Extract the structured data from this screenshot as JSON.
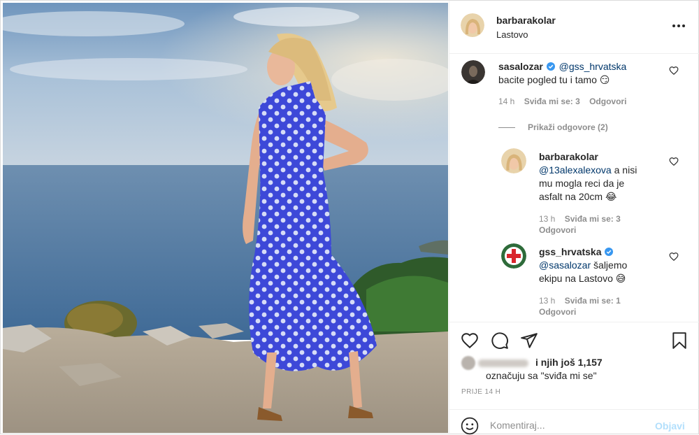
{
  "post": {
    "username": "barbarakolar",
    "location": "Lastovo"
  },
  "comments": [
    {
      "username": "sasalozar",
      "verified": true,
      "mention": "@gss_hrvatska",
      "text": "bacite pogled tu i tamo 😏",
      "time": "14 h",
      "likes": "Sviđa mi se: 3",
      "reply": "Odgovori",
      "view_replies": "Prikaži odgovore (2)",
      "replies": [
        {
          "username": "barbarakolar",
          "mention": "@13alexalexova",
          "text_line1": "a nisi",
          "text_line2": "mu mogla reci da je",
          "text_line3": "asfalt na 20cm 😂",
          "time": "13 h",
          "likes": "Sviđa mi se: 3",
          "reply": "Odgovori"
        },
        {
          "username": "gss_hrvatska",
          "verified": true,
          "mention": "@sasalozar",
          "text_line1": "šaljemo",
          "text_line2": "ekipu na Lastovo 😅",
          "time": "13 h",
          "likes": "Sviđa mi se: 1",
          "reply": "Odgovori"
        }
      ]
    }
  ],
  "likes": {
    "and_more": "i njih još 1,157",
    "line2": "označuju sa \"sviđa mi se\""
  },
  "timestamp": "PRIJE 14 H",
  "composer": {
    "placeholder": "Komentiraj...",
    "post_label": "Objavi"
  },
  "icons": {
    "like": "heart-icon",
    "comment": "comment-icon",
    "share": "send-icon",
    "save": "bookmark-icon",
    "emoji": "emoji-icon",
    "more": "more-options-icon",
    "verified": "verified-badge-icon"
  },
  "colors": {
    "verified": "#3897f0",
    "mention": "#00376b",
    "post_disabled": "#b2dffc",
    "dress": "#3d48d8"
  }
}
